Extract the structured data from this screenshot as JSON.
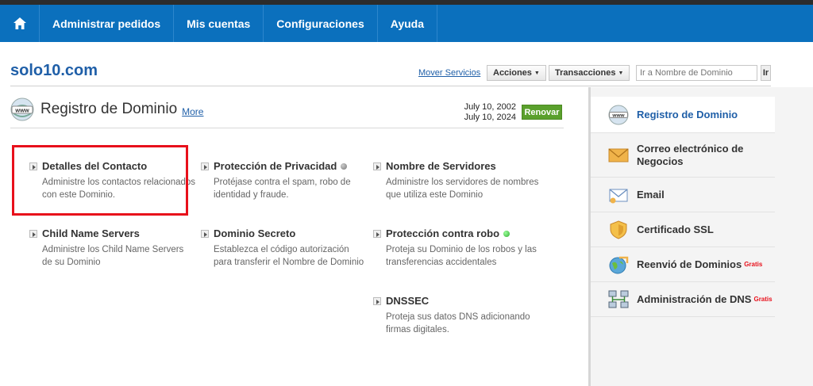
{
  "nav": {
    "items": [
      "Administrar pedidos",
      "Mis cuentas",
      "Configuraciones",
      "Ayuda"
    ]
  },
  "header": {
    "domain": "solo10.com",
    "move_link": "Mover Servicios",
    "acciones": "Acciones",
    "transacciones": "Transacciones",
    "search_placeholder": "Ir a Nombre de Dominio",
    "go": "Ir"
  },
  "section": {
    "title": "Registro de Dominio",
    "more": "More",
    "date1": "July 10, 2002",
    "date2": "July 10, 2024",
    "renew": "Renovar"
  },
  "features": [
    {
      "title": "Detalles del Contacto",
      "desc": "Administre los contactos relacionados con este Dominio."
    },
    {
      "title": "Protección de Privacidad",
      "desc": "Protéjase contra el spam, robo de identidad y fraude.",
      "status": "gray"
    },
    {
      "title": "Nombre de Servidores",
      "desc": "Administre los servidores de nombres que utiliza este Dominio"
    },
    {
      "title": "Child Name Servers",
      "desc": "Administre los Child Name Servers de su Dominio"
    },
    {
      "title": "Dominio Secreto",
      "desc": "Establezca el código autorización para transferir el Nombre de Dominio"
    },
    {
      "title": "Protección contra robo",
      "desc": "Proteja su Dominio de los robos y las transferencias accidentales",
      "status": "green"
    },
    {
      "title": "DNSSEC",
      "desc": "Proteja sus datos DNS adicionando firmas digitales."
    }
  ],
  "sidebar": {
    "items": [
      {
        "label": "Registro de Dominio",
        "icon": "www-globe-icon"
      },
      {
        "label": "Correo electrónico de Negocios",
        "icon": "envelope-icon"
      },
      {
        "label": "Email",
        "icon": "email-icon"
      },
      {
        "label": "Certificado SSL",
        "icon": "shield-icon"
      },
      {
        "label": "Reenvió de Dominios",
        "icon": "globe-arrow-icon",
        "badge": "Gratis"
      },
      {
        "label": "Administración de DNS",
        "icon": "dns-network-icon",
        "badge": "Gratis"
      }
    ]
  },
  "colors": {
    "nav": "#0b70bd",
    "link": "#1f5fa8",
    "renew": "#5aa02c",
    "highlight": "#e8101b"
  }
}
